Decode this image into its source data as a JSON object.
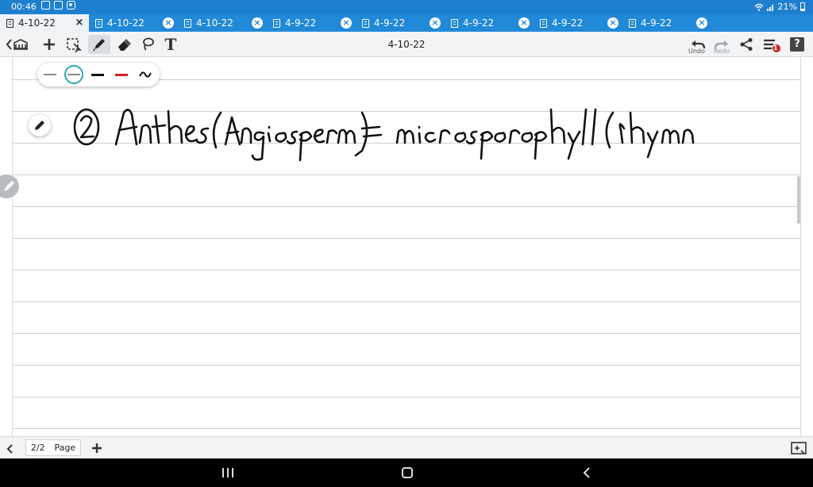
{
  "status": {
    "time": "00:46",
    "battery": "21%"
  },
  "tabs": [
    {
      "label": "4-10-22",
      "active": true
    },
    {
      "label": "4-10-22",
      "active": false
    },
    {
      "label": "4-10-22",
      "active": false
    },
    {
      "label": "4-9-22",
      "active": false
    },
    {
      "label": "4-9-22",
      "active": false
    },
    {
      "label": "4-9-22",
      "active": false
    },
    {
      "label": "4-9-22",
      "active": false
    },
    {
      "label": "4-9-22",
      "active": false
    }
  ],
  "toolbar": {
    "title": "4-10-22",
    "undo_label": "Undo",
    "redo_label": "Redo",
    "text_tool": "T",
    "badge": "1",
    "help": "?"
  },
  "pen_colors": [
    "#8a8a8a",
    "#8a8a8a",
    "#111111",
    "#d32020",
    "#111111"
  ],
  "pagebar": {
    "page_count": "2/2",
    "page_label": "Page"
  }
}
